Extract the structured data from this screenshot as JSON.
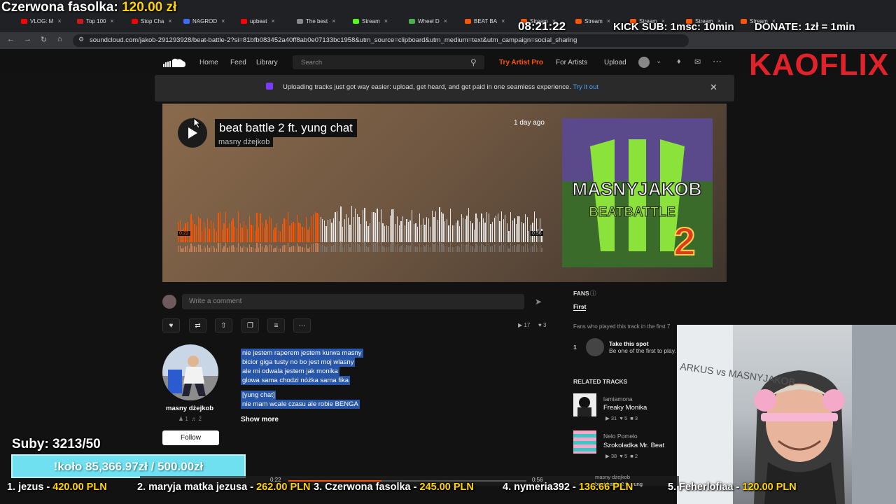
{
  "stream_overlay": {
    "top_left_label": "Czerwona fasolka:",
    "top_left_amount": "120.00 zł",
    "clock": "08:21:22",
    "kick_sub": "KICK SUB: 1msc: 10min",
    "donate": "DONATE: 1zł = 1min",
    "brand": "KAOFLIX",
    "subs": "Suby: 3213/50",
    "wheel": "!koło 85,366.97zł / 500.00zł",
    "ticker": [
      "1. jezus - 420.00 PLN",
      "2. maryja matka jezusa - 262.00 PLN",
      "3. Czerwona fasolka - 245.00 PLN",
      "4. nymeria392 - 136.66 PLN",
      "5. Feherlofiaa - 120.00 PLN"
    ]
  },
  "browser": {
    "tabs": [
      "VLOG: M",
      "Top 100",
      "Stop Cha",
      "NAGROD",
      "upbeat",
      "The best",
      "Stream",
      "Wheel D",
      "BEAT BA",
      "Stream",
      "Stream",
      "Stream",
      "Stream",
      "Stream"
    ],
    "url": "soundcloud.com/jakob-291293928/beat-battle-2?si=81bfb083452a40ff8ab0e07133bc1958&utm_source=clipboard&utm_medium=text&utm_campaign=social_sharing"
  },
  "header": {
    "nav": [
      "Home",
      "Feed",
      "Library"
    ],
    "search_placeholder": "Search",
    "try_pro": "Try Artist Pro",
    "for_artists": "For Artists",
    "upload": "Upload"
  },
  "banner": {
    "text": "Uploading tracks just got way easier: upload, get heard, and get paid in one seamless experience.",
    "link": "Try it out"
  },
  "track": {
    "title": "beat battle 2 ft. yung chat",
    "artist": "masny dżejkob",
    "posted": "1 day ago",
    "elapsed": "0:22",
    "duration": "0:56",
    "progress": 0.39,
    "artwork_lines": [
      "MASNYJAKOB",
      "BEATBATTLE",
      "2"
    ],
    "plays": "17",
    "likes": "3"
  },
  "comment": {
    "placeholder": "Write a comment"
  },
  "uploader": {
    "name": "masny dżejkob",
    "followers": "1",
    "tracks": "2",
    "follow_label": "Follow"
  },
  "description": {
    "lines": [
      "nie jestem raperem jestem kurwa masny",
      "bicior giga tusty no bo jest moj wlasny",
      "ale mi odwala jestem jak monika",
      "glowa sama chodzi nóżka sama fika"
    ],
    "section": "[yung chat]",
    "line2": "nie mam wcale czasu ale robie BENGA",
    "show_more": "Show more"
  },
  "fans": {
    "title": "FANS",
    "tab": "First",
    "note": "Fans who played this track in the first 7",
    "rank": "1",
    "spot_title": "Take this spot",
    "spot_sub": "Be one of the first to play."
  },
  "related": {
    "title": "RELATED TRACKS",
    "items": [
      {
        "artist": "lamiamona",
        "title": "Freaky Monika",
        "plays": "31",
        "likes": "5",
        "comments": "3"
      },
      {
        "artist": "Nelo Pomelo",
        "title": "Szokoladka Mr. Beat",
        "plays": "38",
        "likes": "5",
        "comments": "2"
      }
    ]
  },
  "mini_player": {
    "elapsed": "0:22",
    "duration": "0:56",
    "artist": "masny dżejkob",
    "title": "beat battle 2 ft. yung"
  },
  "webcam": {
    "whiteboard_text": "ARKUS vs MASNYJAKOB"
  }
}
